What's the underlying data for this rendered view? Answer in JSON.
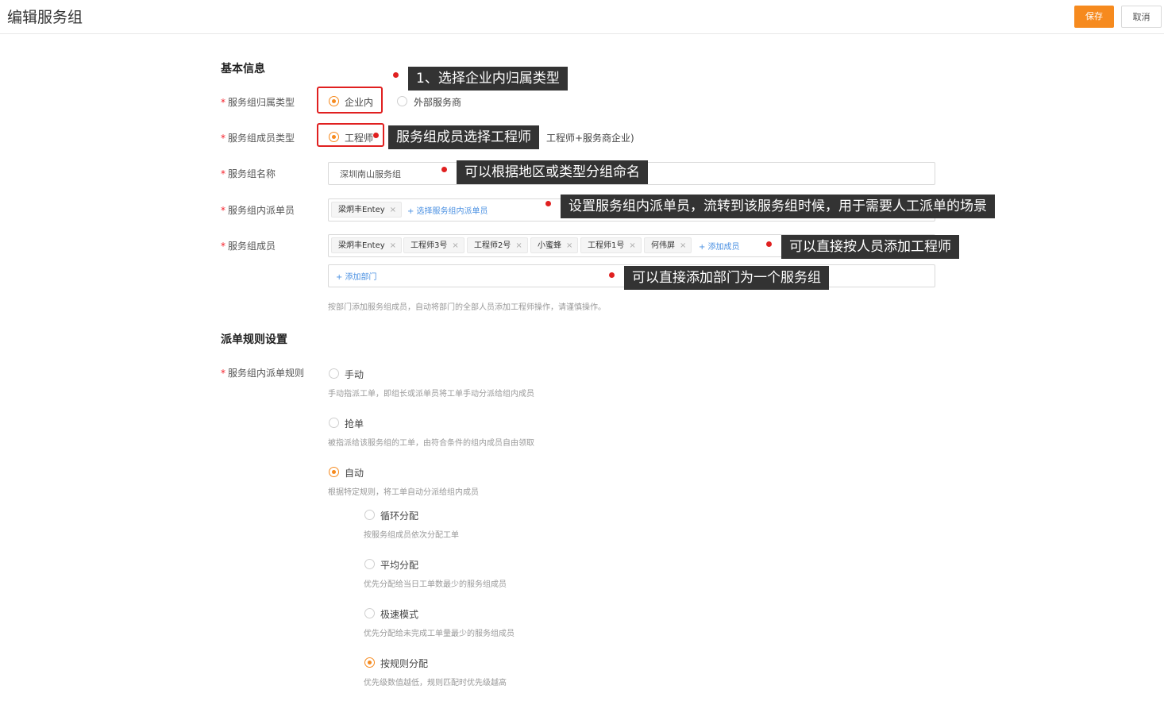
{
  "header": {
    "title": "编辑服务组",
    "save_label": "保存",
    "cancel_label": "取消"
  },
  "basic": {
    "title": "基本信息",
    "owner_type": {
      "label": "服务组归属类型",
      "options": [
        "企业内",
        "外部服务商"
      ],
      "selected": "企业内"
    },
    "member_type": {
      "label": "服务组成员类型",
      "option": "工程师",
      "overflow_text": "工程师+服务商企业)"
    },
    "name": {
      "label": "服务组名称",
      "value": "深圳南山服务组"
    },
    "dispatcher": {
      "label": "服务组内派单员",
      "tags": [
        "梁炯丰Entey"
      ],
      "add_link": "+ 选择服务组内派单员"
    },
    "members": {
      "label": "服务组成员",
      "tags": [
        "梁炯丰Entey",
        "工程师3号",
        "工程师2号",
        "小蜜蜂",
        "工程师1号",
        "何伟屏"
      ],
      "add_link": "+ 添加成员",
      "add_dept_link": "+ 添加部门",
      "hint": "按部门添加服务组成员，自动将部门的全部人员添加工程师操作，请谨慎操作。"
    }
  },
  "dispatch": {
    "title": "派单规则设置",
    "rule_label": "服务组内派单规则",
    "rules": [
      {
        "label": "手动",
        "hint": "手动指派工单，即组长或派单员将工单手动分派给组内成员",
        "selected": false
      },
      {
        "label": "抢单",
        "hint": "被指派给该服务组的工单，由符合条件的组内成员自由领取",
        "selected": false
      },
      {
        "label": "自动",
        "hint": "根据特定规则，将工单自动分派给组内成员",
        "selected": true
      }
    ],
    "auto_rules": [
      {
        "label": "循环分配",
        "hint": "按服务组成员依次分配工单",
        "selected": false
      },
      {
        "label": "平均分配",
        "hint": "优先分配给当日工单数最少的服务组成员",
        "selected": false
      },
      {
        "label": "极速模式",
        "hint": "优先分配给未完成工单量最少的服务组成员",
        "selected": false
      },
      {
        "label": "按规则分配",
        "hint": "优先级数值越低，规则匹配时优先级越高",
        "selected": true
      }
    ]
  },
  "annotations": [
    "1、选择企业内归属类型",
    "服务组成员选择工程师",
    "可以根据地区或类型分组命名",
    "设置服务组内派单员，流转到该服务组时候，用于需要人工派单的场景",
    "可以直接按人员添加工程师",
    "可以直接添加部门为一个服务组"
  ],
  "colors": {
    "accent": "#f68a1e",
    "annotation_red": "#e02020",
    "callout_bg": "#333333",
    "link": "#4a90e2"
  }
}
